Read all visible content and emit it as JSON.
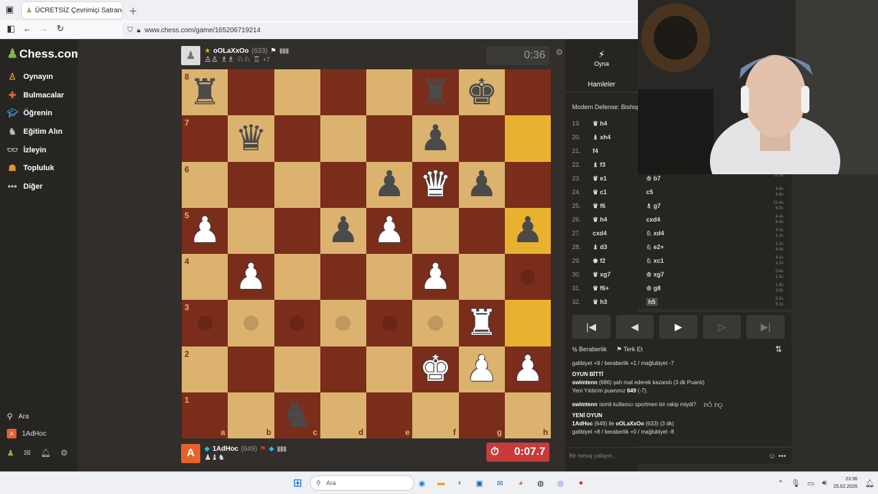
{
  "browser": {
    "tab_title": "ÜCRETSİZ Çevrimiçi Satranç",
    "url": "www.chess.com/game/165206719214"
  },
  "sidebar": {
    "logo": "Chess.com",
    "items": [
      {
        "label": "Oynayın",
        "icon": "play-icon"
      },
      {
        "label": "Bulmacalar",
        "icon": "puzzle-icon"
      },
      {
        "label": "Öğrenin",
        "icon": "learn-icon"
      },
      {
        "label": "Eğitim Alın",
        "icon": "coach-icon"
      },
      {
        "label": "İzleyin",
        "icon": "watch-icon"
      },
      {
        "label": "Topluluk",
        "icon": "community-icon"
      },
      {
        "label": "Diğer",
        "icon": "more-icon"
      }
    ],
    "search": "Ara",
    "user": "1AdHoc",
    "user_avatar_letter": "A"
  },
  "top_player": {
    "name": "oOLaXxOo",
    "rating": "(633)",
    "captured_extra": "+7",
    "clock": "0:36"
  },
  "bottom_player": {
    "name": "1AdHoc",
    "rating": "(649)",
    "avatar_letter": "A",
    "clock": "0:07.7"
  },
  "board": {
    "ranks": [
      "8",
      "7",
      "6",
      "5",
      "4",
      "3",
      "2",
      "1"
    ],
    "files": [
      "a",
      "b",
      "c",
      "d",
      "e",
      "f",
      "g",
      "h"
    ],
    "rows": [
      [
        "bR",
        "",
        "",
        "",
        "",
        "bR",
        "bK",
        ""
      ],
      [
        "",
        "bQ",
        "",
        "",
        "",
        "bP",
        "",
        ""
      ],
      [
        "",
        "",
        "",
        "",
        "bP",
        "wQ",
        "bP",
        ""
      ],
      [
        "wP",
        "",
        "",
        "bP",
        "wP",
        "",
        "",
        "bP"
      ],
      [
        "",
        "wP",
        "",
        "",
        "",
        "wP",
        "",
        ""
      ],
      [
        "",
        "",
        "",
        "",
        "",
        "",
        "wR",
        ""
      ],
      [
        "",
        "",
        "",
        "",
        "",
        "wK",
        "wP",
        "wP"
      ],
      [
        "",
        "",
        "bN",
        "",
        "",
        "",
        "",
        ""
      ]
    ],
    "highlight": [
      "h7",
      "h5",
      "h3"
    ],
    "dots": [
      "a3",
      "b3",
      "c3",
      "d3",
      "e3",
      "f3",
      "h4"
    ]
  },
  "panel": {
    "play_tab": "Oyna",
    "moves_tab": "Hamleler",
    "opening": "Modern Defense: Bishop"
  },
  "moves": [
    {
      "n": "19.",
      "w": "♛ h4",
      "b": "",
      "t1": "",
      "t2": ""
    },
    {
      "n": "20.",
      "w": "♝ xh4",
      "b": "",
      "t1": "",
      "t2": ""
    },
    {
      "n": "21.",
      "w": "f4",
      "b": "",
      "t1": "",
      "t2": ""
    },
    {
      "n": "22.",
      "w": "♝ f3",
      "b": "",
      "t1": "",
      "t2": ""
    },
    {
      "n": "23.",
      "w": "♛ e1",
      "b": "♔ b7",
      "t1": "",
      "t2": "17.0s"
    },
    {
      "n": "24.",
      "w": "♛ c1",
      "b": "c5",
      "t1": "4.8s",
      "t2": "6.8s"
    },
    {
      "n": "25.",
      "w": "♛ f6",
      "b": "♗ g7",
      "t1": "21.4s",
      "t2": "6.0s"
    },
    {
      "n": "26.",
      "w": "♛ h4",
      "b": "cxd4",
      "t1": "4.4s",
      "t2": "8.4s"
    },
    {
      "n": "27.",
      "w": "cxd4",
      "b": "♘ xd4",
      "t1": "4.0s",
      "t2": "1.1s"
    },
    {
      "n": "28.",
      "w": "♝ d3",
      "b": "♘ e2+",
      "t1": "1.0s",
      "t2": "6.4s"
    },
    {
      "n": "29.",
      "w": "♚ f2",
      "b": "♘ xc1",
      "t1": "4.1s",
      "t2": "1.2s"
    },
    {
      "n": "30.",
      "w": "♛ xg7",
      "b": "♔ xg7",
      "t1": "0.4s",
      "t2": "1.5s"
    },
    {
      "n": "31.",
      "w": "♛ f6+",
      "b": "♔ g8",
      "t1": "1.6s",
      "t2": "3.9s"
    },
    {
      "n": "32.",
      "w": "♛ h3",
      "b": "h5",
      "t1": "0.5s",
      "t2": "5.1s"
    }
  ],
  "actions": {
    "draw": "Beraberlik",
    "resign": "Terk Et"
  },
  "chat": {
    "line1": "galibiyet +9 / beraberlik +1 / mağlubiyet -7",
    "over_title": "OYUN BİTTİ",
    "over_winner": "swimtenn",
    "over_text": "(686) şah mat ederek kazandı (3 dk Puanlı)",
    "rating_text": "Yeni Yıldırım puanınız",
    "rating_val": "649",
    "rating_delta": "(-7).",
    "sport_q": "isimli kullanıcı sportmen bir rakip miydi?",
    "sport_user": "swimtenn",
    "new_title": "YENİ OYUN",
    "new_p1": "1AdHoc",
    "new_mid": "(649) ile",
    "new_p2": "oOLaXxOo",
    "new_end": "(633) (3 dk)",
    "line_last": "galibiyet +8 / beraberlik +0 / mağlubiyet -8",
    "placeholder": "Bir mesaj yollayın..."
  },
  "taskbar": {
    "search": "Ara",
    "time": "23:36",
    "date": "25.02.2026"
  }
}
